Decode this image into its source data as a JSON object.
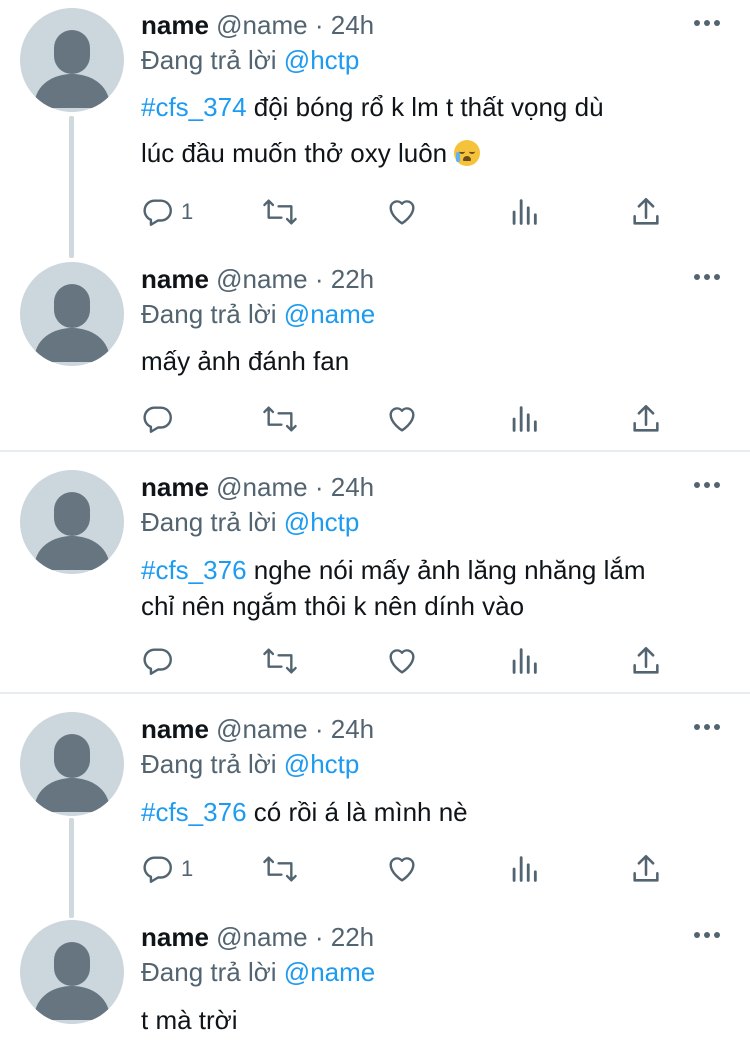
{
  "colors": {
    "link": "#1d9bf0",
    "secondary_text": "#536471",
    "avatar_bg": "#ccd6dd",
    "thread_line": "#cfd9de"
  },
  "tweets": [
    {
      "name": "name",
      "handle": "@name",
      "sep": "·",
      "time": "24h",
      "replying_prefix": "Đang trả lời",
      "replying_to": "@hctp",
      "hashtag": "#cfs_374",
      "text_line1": " đội bóng rổ k lm t thất vọng dù",
      "text_line2": "lúc đầu muốn thở oxy luôn",
      "emoji": "crying-face-emoji",
      "reply_count": "1"
    },
    {
      "name": "name",
      "handle": "@name",
      "sep": "·",
      "time": "22h",
      "replying_prefix": "Đang trả lời",
      "replying_to": "@name",
      "text": "mấy ảnh đánh fan"
    },
    {
      "name": "name",
      "handle": "@name",
      "sep": "·",
      "time": "24h",
      "replying_prefix": "Đang trả lời",
      "replying_to": "@hctp",
      "hashtag": "#cfs_376",
      "text_line1": " nghe nói mấy ảnh lăng nhăng lắm",
      "text_line2": "chỉ nên ngắm thôi k nên dính vào"
    },
    {
      "name": "name",
      "handle": "@name",
      "sep": "·",
      "time": "24h",
      "replying_prefix": "Đang trả lời",
      "replying_to": "@hctp",
      "hashtag": "#cfs_376",
      "text_line1": " có rồi á là mình nè",
      "reply_count": "1"
    },
    {
      "name": "name",
      "handle": "@name",
      "sep": "·",
      "time": "22h",
      "replying_prefix": "Đang trả lời",
      "replying_to": "@name",
      "text": "t mà trời"
    }
  ]
}
